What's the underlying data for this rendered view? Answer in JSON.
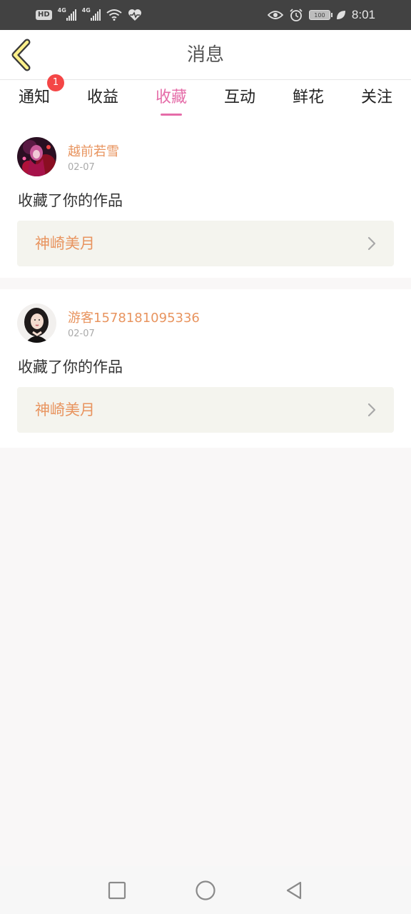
{
  "status_bar": {
    "hd": "HD",
    "net1": "4G",
    "net2": "4G",
    "battery_level": "100",
    "time": "8:01",
    "icons": [
      "hd-icon",
      "signal-icon",
      "signal-icon",
      "wifi-icon",
      "heart-pulse-icon",
      "eye-icon",
      "alarm-icon",
      "battery-icon",
      "leaf-icon"
    ]
  },
  "header": {
    "title": "消息",
    "back_icon": "back-chevron-icon"
  },
  "tabs": [
    {
      "label": "通知",
      "badge": "1"
    },
    {
      "label": "收益"
    },
    {
      "label": "收藏",
      "active": true
    },
    {
      "label": "互动"
    },
    {
      "label": "鲜花"
    },
    {
      "label": "关注"
    }
  ],
  "colors": {
    "accent": "#e56ca8",
    "username": "#e8945f",
    "badge": "#f44646",
    "link_bg": "#f4f4ee"
  },
  "feed": [
    {
      "username": "越前若雪",
      "date": "02-07",
      "action": "收藏了你的作品",
      "work_title": "神崎美月"
    },
    {
      "username": "游客1578181095336",
      "date": "02-07",
      "action": "收藏了你的作品",
      "work_title": "神崎美月"
    }
  ],
  "nav_bar": {
    "icons": [
      "recents-square-icon",
      "home-circle-icon",
      "back-triangle-icon"
    ]
  }
}
